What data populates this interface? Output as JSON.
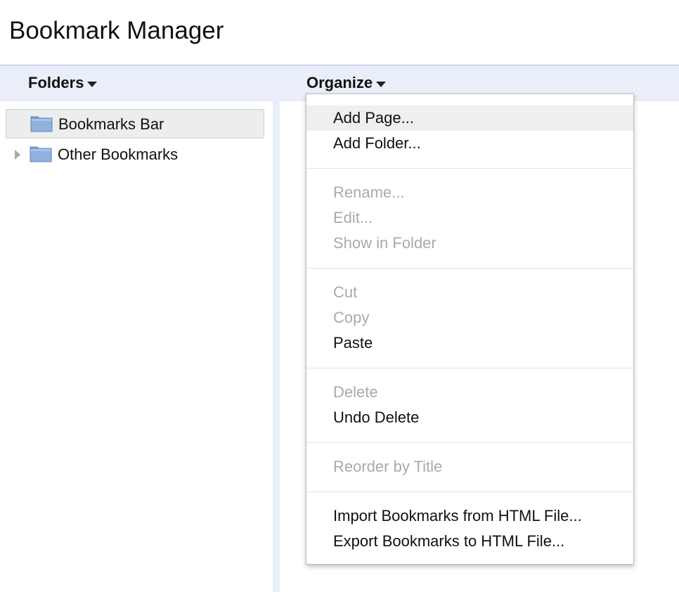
{
  "app": {
    "title": "Bookmark Manager"
  },
  "toolbar": {
    "folders_label": "Folders",
    "organize_label": "Organize"
  },
  "folder_tree": {
    "items": [
      {
        "label": "Bookmarks Bar",
        "selected": true,
        "expandable": false
      },
      {
        "label": "Other Bookmarks",
        "selected": false,
        "expandable": true
      }
    ]
  },
  "organize_menu": {
    "groups": [
      [
        {
          "label": "Add Page...",
          "enabled": true,
          "highlighted": true
        },
        {
          "label": "Add Folder...",
          "enabled": true
        }
      ],
      [
        {
          "label": "Rename...",
          "enabled": false
        },
        {
          "label": "Edit...",
          "enabled": false
        },
        {
          "label": "Show in Folder",
          "enabled": false
        }
      ],
      [
        {
          "label": "Cut",
          "enabled": false
        },
        {
          "label": "Copy",
          "enabled": false
        },
        {
          "label": "Paste",
          "enabled": true
        }
      ],
      [
        {
          "label": "Delete",
          "enabled": false
        },
        {
          "label": "Undo Delete",
          "enabled": true
        }
      ],
      [
        {
          "label": "Reorder by Title",
          "enabled": false
        }
      ],
      [
        {
          "label": "Import Bookmarks from HTML File...",
          "enabled": true
        },
        {
          "label": "Export Bookmarks to HTML File...",
          "enabled": true
        }
      ]
    ]
  },
  "colors": {
    "toolbar_bg": "#e9eef9",
    "disabled_text": "#aaaaaa",
    "folder_icon": "#8fb1dd"
  }
}
